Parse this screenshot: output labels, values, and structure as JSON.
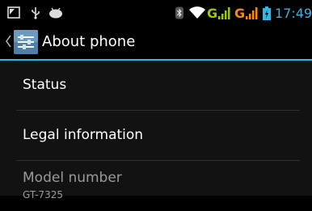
{
  "status_bar": {
    "network_1": "G",
    "network_2": "G",
    "time": "17:49",
    "left_icons": [
      "screenshot-icon",
      "usb-icon",
      "android-debug-icon"
    ],
    "right_icons": [
      "bluetooth-icon",
      "wifi-icon",
      "signal-icon",
      "signal-icon",
      "battery-icon"
    ]
  },
  "action_bar": {
    "title": "About phone",
    "icon": "settings-icon"
  },
  "list": {
    "items": [
      {
        "label": "Status"
      },
      {
        "label": "Legal information"
      },
      {
        "label": "Model number",
        "value": "GT-7325"
      }
    ]
  },
  "colors": {
    "accent": "#33b5e5",
    "green": "#99cc00",
    "orange": "#ff8800",
    "list_bg": "#121212",
    "text_secondary": "#9a9a9a"
  }
}
